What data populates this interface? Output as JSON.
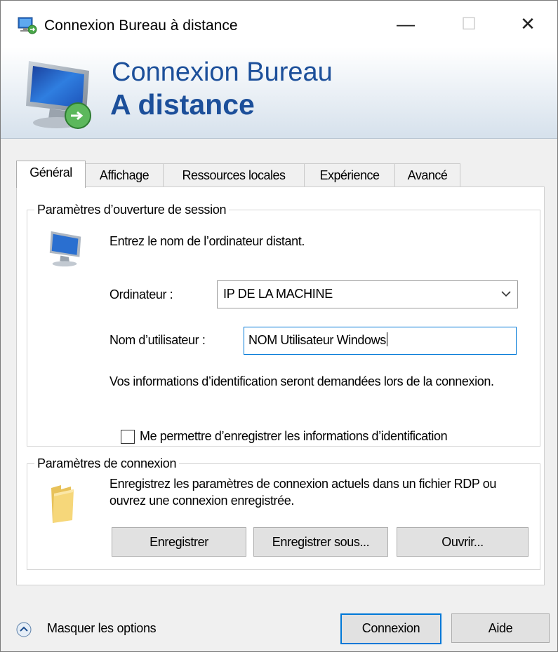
{
  "window": {
    "title": "Connexion Bureau à distance",
    "minimize_glyph": "—",
    "maximize_glyph": "☐",
    "close_glyph": "✕"
  },
  "banner": {
    "line1": "Connexion Bureau",
    "line2": "A distance"
  },
  "tabs": [
    {
      "label": "Général",
      "active": true
    },
    {
      "label": "Affichage",
      "active": false
    },
    {
      "label": "Ressources locales",
      "active": false
    },
    {
      "label": "Expérience",
      "active": false
    },
    {
      "label": "Avancé",
      "active": false
    }
  ],
  "logon": {
    "group_title": "Paramètres d’ouverture de session",
    "instruction": "Entrez le nom de l’ordinateur distant.",
    "computer_label": "Ordinateur :",
    "computer_value": "IP DE LA MACHINE",
    "username_label": "Nom d’utilisateur :",
    "username_value": "NOM Utilisateur Windows",
    "info_text": "Vos informations d’identification seront demandées lors de la connexion.",
    "save_credentials_label": "Me permettre d’enregistrer les informations d’identification",
    "save_credentials_checked": false
  },
  "connection": {
    "group_title": "Paramètres de connexion",
    "description": "Enregistrez les paramètres de connexion actuels dans un fichier RDP ou ouvrez une connexion enregistrée.",
    "save_button": "Enregistrer",
    "save_as_button": "Enregistrer sous...",
    "open_button": "Ouvrir..."
  },
  "footer": {
    "toggle_label": "Masquer les options",
    "connect_button": "Connexion",
    "help_button": "Aide"
  },
  "icons": {
    "app": "remote-desktop-icon",
    "banner": "monitor-remote-icon",
    "computer": "computer-icon",
    "folder": "folder-icon",
    "combo_arrow": "chevron-down-icon",
    "toggle": "chevron-up-circle-icon"
  },
  "colors": {
    "accent": "#0078d7",
    "banner_text": "#1c4f9a",
    "button_face": "#e1e1e1",
    "dialog_bg": "#f0f0f0"
  }
}
